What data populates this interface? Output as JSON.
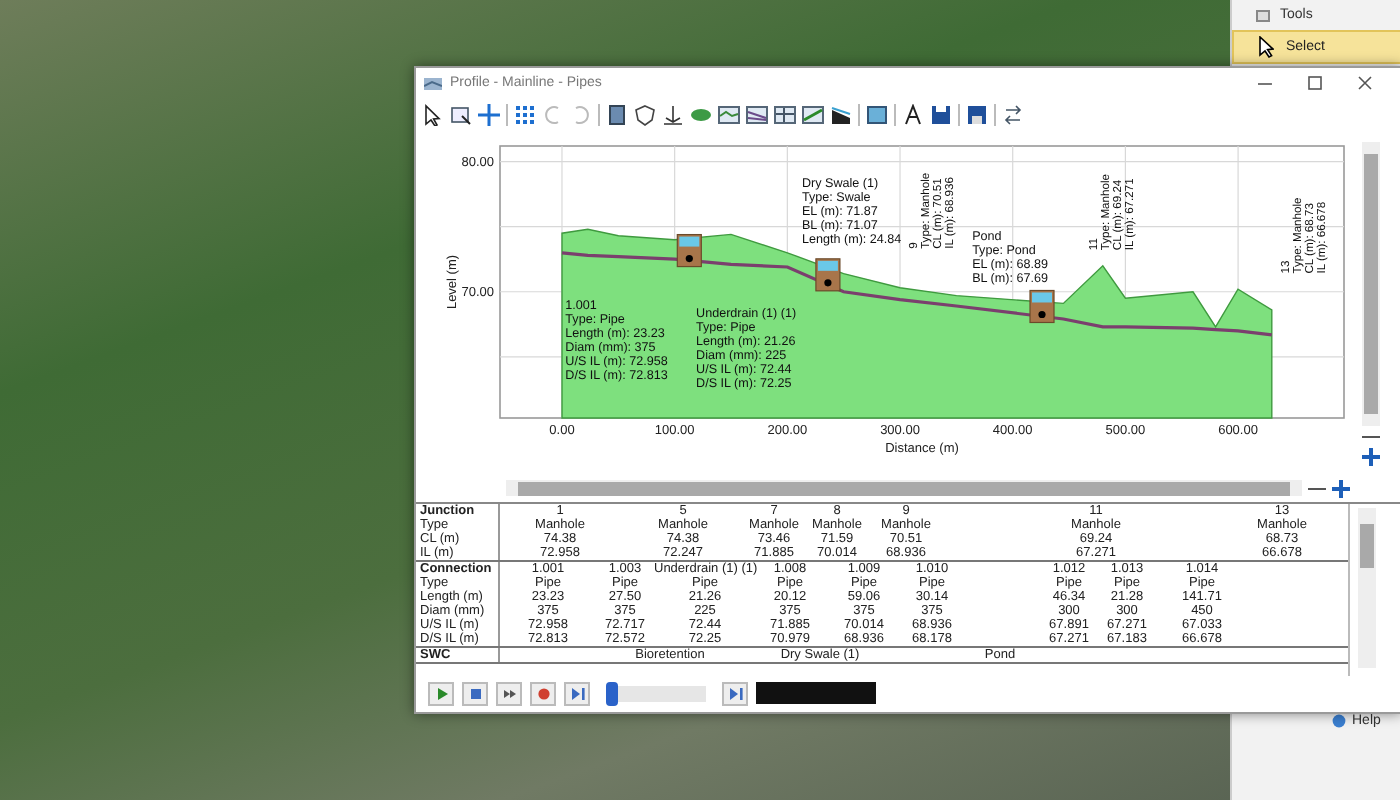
{
  "tools_panel": {
    "title": "Tools",
    "items": [
      {
        "label": "Select",
        "selected": true
      }
    ],
    "help": "Help"
  },
  "window": {
    "title": "Profile - Mainline - Pipes"
  },
  "profile": {
    "chart_data": {
      "type": "area",
      "xlabel": "Distance (m)",
      "ylabel": "Level (m)",
      "grid": true,
      "x": [
        0,
        23,
        50,
        100,
        150,
        200,
        250,
        300,
        350,
        445,
        480,
        500,
        560,
        580,
        600,
        630
      ],
      "series": [
        {
          "type": "area",
          "color": "#7ee07e",
          "values": [
            74.5,
            74.8,
            74.3,
            74.0,
            74.4,
            73.0,
            71.4,
            70.3,
            69.7,
            69.1,
            72.0,
            69.5,
            70.0,
            67.3,
            70.2,
            68.6
          ]
        },
        {
          "type": "line",
          "color": "#7b3f6e",
          "values": [
            73.0,
            72.8,
            72.7,
            72.5,
            72.1,
            71.9,
            70.0,
            69.4,
            68.9,
            67.9,
            67.3,
            67.3,
            67.2,
            67.1,
            67.0,
            66.7
          ]
        }
      ],
      "xlim": [
        -55,
        694
      ],
      "ylim": [
        60.3,
        81.2
      ],
      "xticks": [
        {
          "value": 0,
          "label": "0.00"
        },
        {
          "value": 100,
          "label": "100.00"
        },
        {
          "value": 200,
          "label": "200.00"
        },
        {
          "value": 300,
          "label": "300.00"
        },
        {
          "value": 400,
          "label": "400.00"
        },
        {
          "value": 500,
          "label": "500.00"
        },
        {
          "value": 600,
          "label": "600.00"
        }
      ],
      "yticks": [
        {
          "value": 70,
          "label": "70.00"
        },
        {
          "value": 80,
          "label": "80.00"
        }
      ]
    },
    "labels": [
      {
        "kind": "horizontal",
        "lines": [
          "1.001",
          "Type: Pipe",
          "Length (m): 23.23",
          "Diam (mm): 375",
          "U/S IL (m): 72.958",
          "D/S IL (m): 72.813"
        ]
      },
      {
        "kind": "horizontal",
        "lines": [
          "Underdrain (1) (1)",
          "Type: Pipe",
          "Length (m): 21.26",
          "Diam (mm): 225",
          "U/S IL (m): 72.44",
          "D/S IL (m): 72.25"
        ]
      },
      {
        "kind": "horizontal",
        "lines": [
          "Dry Swale (1)",
          "Type: Swale",
          "EL (m): 71.87",
          "BL (m): 71.07",
          "Length (m): 24.84"
        ]
      },
      {
        "kind": "vertical",
        "lines": [
          "9",
          "Type: Manhole",
          "CL (m): 70.51",
          "IL (m): 68.936"
        ]
      },
      {
        "kind": "horizontal",
        "lines": [
          "Pond",
          "Type: Pond",
          "EL (m): 68.89",
          "BL (m): 67.69"
        ]
      },
      {
        "kind": "vertical",
        "lines": [
          "11",
          "Type: Manhole",
          "CL (m): 69.24",
          "IL (m): 67.271"
        ]
      },
      {
        "kind": "vertical",
        "lines": [
          "13",
          "Type: Manhole",
          "CL (m): 68.73",
          "IL (m): 66.678"
        ]
      }
    ]
  },
  "table": {
    "sections": [
      {
        "rows": [
          {
            "label": "Junction",
            "cells": [
              "1",
              "5",
              "7",
              "8",
              "9",
              "11",
              "13"
            ]
          },
          {
            "label": "Type",
            "cells": [
              "Manhole",
              "Manhole",
              "Manhole",
              "Manhole",
              "Manhole",
              "Manhole",
              "Manhole"
            ]
          },
          {
            "label": "CL (m)",
            "cells": [
              "74.38",
              "74.38",
              "73.46",
              "71.59",
              "70.51",
              "69.24",
              "68.73"
            ]
          },
          {
            "label": "IL (m)",
            "cells": [
              "72.958",
              "72.247",
              "71.885",
              "70.014",
              "68.936",
              "67.271",
              "66.678"
            ]
          }
        ]
      },
      {
        "rows": [
          {
            "label": "Connection",
            "cells": [
              "1.001",
              "1.003",
              "Underdrain (1) (1)",
              "1.008",
              "1.009",
              "1.010",
              "1.012",
              "1.013",
              "1.014"
            ]
          },
          {
            "label": "Type",
            "cells": [
              "Pipe",
              "Pipe",
              "Pipe",
              "Pipe",
              "Pipe",
              "Pipe",
              "Pipe",
              "Pipe",
              "Pipe"
            ]
          },
          {
            "label": "Length (m)",
            "cells": [
              "23.23",
              "27.50",
              "21.26",
              "20.12",
              "59.06",
              "30.14",
              "46.34",
              "21.28",
              "141.71"
            ]
          },
          {
            "label": "Diam (mm)",
            "cells": [
              "375",
              "375",
              "225",
              "375",
              "375",
              "375",
              "300",
              "300",
              "450"
            ]
          },
          {
            "label": "U/S IL (m)",
            "cells": [
              "72.958",
              "72.717",
              "72.44",
              "71.885",
              "70.014",
              "68.936",
              "67.891",
              "67.271",
              "67.033"
            ]
          },
          {
            "label": "D/S IL (m)",
            "cells": [
              "72.813",
              "72.572",
              "72.25",
              "70.979",
              "68.936",
              "68.178",
              "67.271",
              "67.183",
              "66.678"
            ]
          }
        ]
      },
      {
        "rows": [
          {
            "label": "SWC",
            "cells": [
              "Bioretention",
              "Dry Swale (1)",
              "Pond"
            ]
          }
        ]
      }
    ]
  },
  "playback": {
    "level": 0
  }
}
